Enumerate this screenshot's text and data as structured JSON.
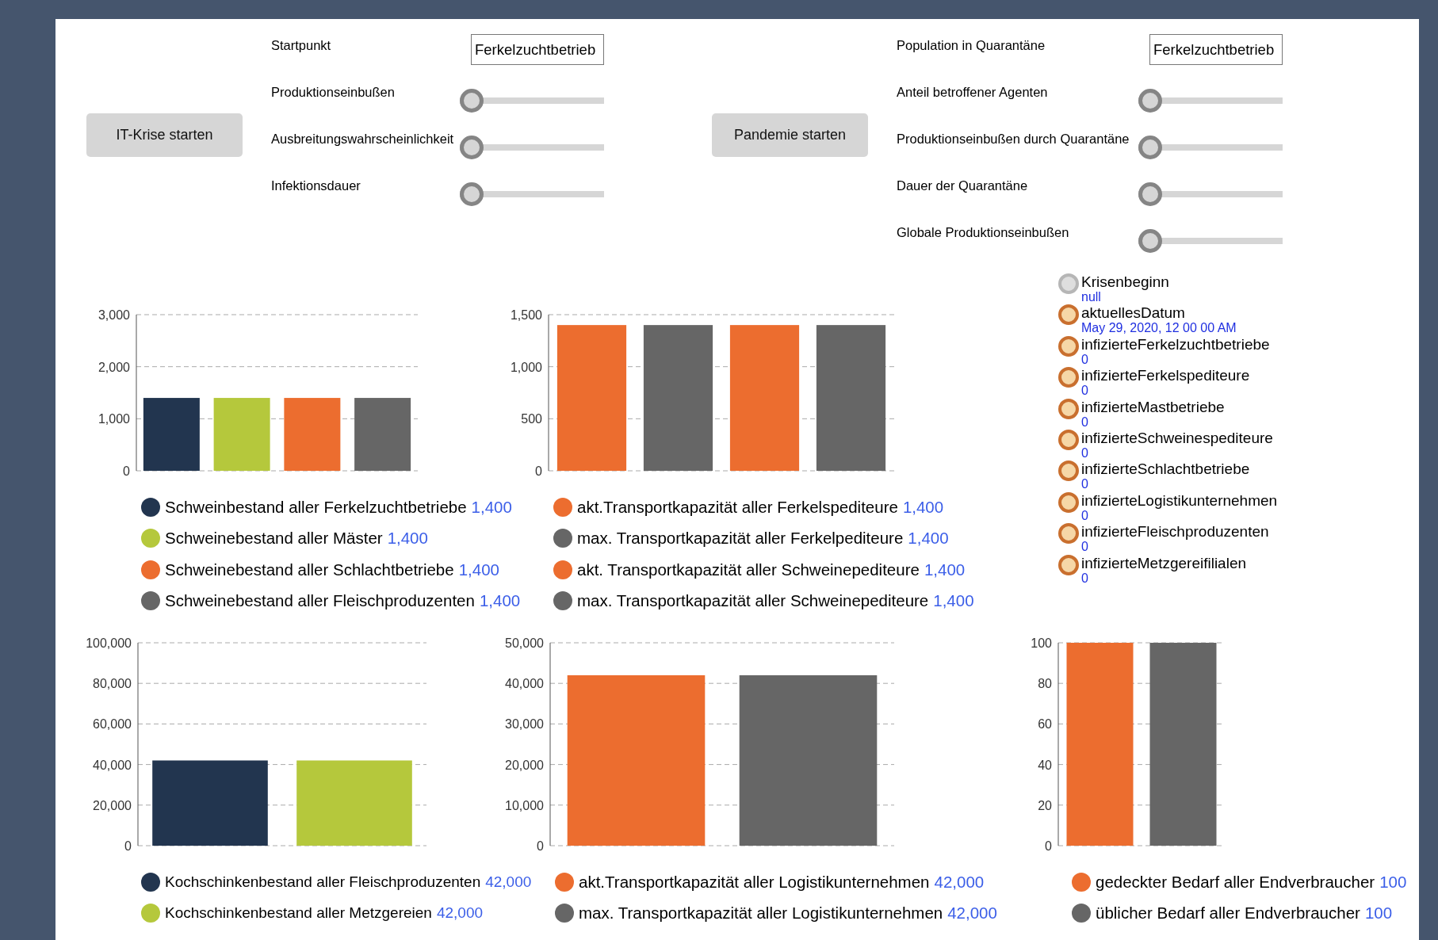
{
  "control_groups": [
    {
      "button": "IT-Krise starten",
      "field": {
        "label": "Startpunkt",
        "value": "Ferkelzuchtbetrieb"
      },
      "sliders": [
        {
          "label": "Produktionseinbußen",
          "level": 0
        },
        {
          "label": "Ausbreitungswahrscheinlichkeit",
          "level": 0
        },
        {
          "label": "Infektionsdauer",
          "level": 0
        }
      ]
    },
    {
      "button": "Pandemie starten",
      "field": {
        "label": "Population in Quarantäne",
        "value": "Ferkelzuchtbetrieb"
      },
      "sliders": [
        {
          "label": "Anteil betroffener Agenten",
          "level": 0
        },
        {
          "label": "Produktionseinbußen durch Quarantäne",
          "level": 0
        },
        {
          "label": "Dauer der Quarantäne",
          "level": 0
        },
        {
          "label": "Globale Produktionseinbußen",
          "level": 0
        }
      ]
    }
  ],
  "status_list": [
    {
      "name": "Krisenbeginn",
      "value": "null",
      "active": false
    },
    {
      "name": "aktuellesDatum",
      "value": "May 29, 2020, 12 00 00 AM",
      "active": true
    },
    {
      "name": "infizierteFerkelzuchtbetriebe",
      "value": "0",
      "active": true
    },
    {
      "name": "infizierteFerkelspediteure",
      "value": "0",
      "active": true
    },
    {
      "name": "infizierteMastbetriebe",
      "value": "0",
      "active": true
    },
    {
      "name": "infizierteSchweinespediteure",
      "value": "0",
      "active": true
    },
    {
      "name": "infizierteSchlachtbetriebe",
      "value": "0",
      "active": true
    },
    {
      "name": "infizierteLogistikunternehmen",
      "value": "0",
      "active": true
    },
    {
      "name": "infizierteFleischproduzenten",
      "value": "0",
      "active": true
    },
    {
      "name": "infizierteMetzgereifilialen",
      "value": "0",
      "active": true
    }
  ],
  "charts": [
    {
      "chart_data": {
        "type": "bar",
        "grid": true,
        "values": [
          1400,
          1400,
          1400,
          1400
        ],
        "ylim": [
          0,
          3000
        ],
        "yticks": [
          {
            "value": 0,
            "label": "0"
          },
          {
            "value": 1000,
            "label": "1,000"
          },
          {
            "value": 2000,
            "label": "2,000"
          },
          {
            "value": 3000,
            "label": "3,000"
          }
        ]
      },
      "legend": [
        {
          "label": "Schweinbestand aller Ferkelzuchtbetriebe",
          "value": "1,400",
          "color": "#22354f"
        },
        {
          "label": "Schweinebestand aller Mäster",
          "value": "1,400",
          "color": "#b5c83c"
        },
        {
          "label": "Schweinebestand aller Schlachtbetriebe",
          "value": "1,400",
          "color": "#ec6d2f"
        },
        {
          "label": "Schweinebestand aller Fleischproduzenten",
          "value": "1,400",
          "color": "#666666"
        }
      ]
    },
    {
      "chart_data": {
        "type": "bar",
        "grid": true,
        "values": [
          1400,
          1400,
          1400,
          1400
        ],
        "ylim": [
          0,
          1500
        ],
        "yticks": [
          {
            "value": 0,
            "label": "0"
          },
          {
            "value": 500,
            "label": "500"
          },
          {
            "value": 1000,
            "label": "1,000"
          },
          {
            "value": 1500,
            "label": "1,500"
          }
        ]
      },
      "legend": [
        {
          "label": "akt.Transportkapazität aller Ferkelspediteure",
          "value": "1,400",
          "color": "#ec6d2f"
        },
        {
          "label": "max. Transportkapazität aller Ferkelpediteure",
          "value": "1,400",
          "color": "#666666"
        },
        {
          "label": "akt. Transportkapazität aller Schweinepediteure",
          "value": "1,400",
          "color": "#ec6d2f"
        },
        {
          "label": "max. Transportkapazität aller Schweinepediteure",
          "value": "1,400",
          "color": "#666666"
        }
      ]
    },
    {
      "chart_data": {
        "type": "bar",
        "grid": true,
        "values": [
          42000,
          42000
        ],
        "ylim": [
          0,
          100000
        ],
        "yticks": [
          {
            "value": 0,
            "label": "0"
          },
          {
            "value": 20000,
            "label": "20,000"
          },
          {
            "value": 40000,
            "label": "40,000"
          },
          {
            "value": 60000,
            "label": "60,000"
          },
          {
            "value": 80000,
            "label": "80,000"
          },
          {
            "value": 100000,
            "label": "100,000"
          }
        ]
      },
      "legend": [
        {
          "label": "Kochschinkenbestand aller Fleischproduzenten",
          "value": "42,000",
          "color": "#22354f"
        },
        {
          "label": "Kochschinkenbestand aller Metzgereien",
          "value": "42,000",
          "color": "#b5c83c"
        }
      ]
    },
    {
      "chart_data": {
        "type": "bar",
        "grid": true,
        "values": [
          42000,
          42000
        ],
        "ylim": [
          0,
          50000
        ],
        "yticks": [
          {
            "value": 0,
            "label": "0"
          },
          {
            "value": 10000,
            "label": "10,000"
          },
          {
            "value": 20000,
            "label": "20,000"
          },
          {
            "value": 30000,
            "label": "30,000"
          },
          {
            "value": 40000,
            "label": "40,000"
          },
          {
            "value": 50000,
            "label": "50,000"
          }
        ]
      },
      "legend": [
        {
          "label": "akt.Transportkapazität aller Logistikunternehmen",
          "value": "42,000",
          "color": "#ec6d2f"
        },
        {
          "label": "max. Transportkapazität aller Logistikunternehmen",
          "value": "42,000",
          "color": "#666666"
        }
      ]
    },
    {
      "chart_data": {
        "type": "bar",
        "grid": true,
        "values": [
          100,
          100
        ],
        "ylim": [
          0,
          100
        ],
        "yticks": [
          {
            "value": 0,
            "label": "0"
          },
          {
            "value": 20,
            "label": "20"
          },
          {
            "value": 40,
            "label": "40"
          },
          {
            "value": 60,
            "label": "60"
          },
          {
            "value": 80,
            "label": "80"
          },
          {
            "value": 100,
            "label": "100"
          }
        ]
      },
      "legend": [
        {
          "label": "gedeckter Bedarf aller Endverbraucher",
          "value": "100",
          "color": "#ec6d2f"
        },
        {
          "label": "üblicher Bedarf aller Endverbraucher",
          "value": "100",
          "color": "#666666"
        }
      ]
    }
  ]
}
